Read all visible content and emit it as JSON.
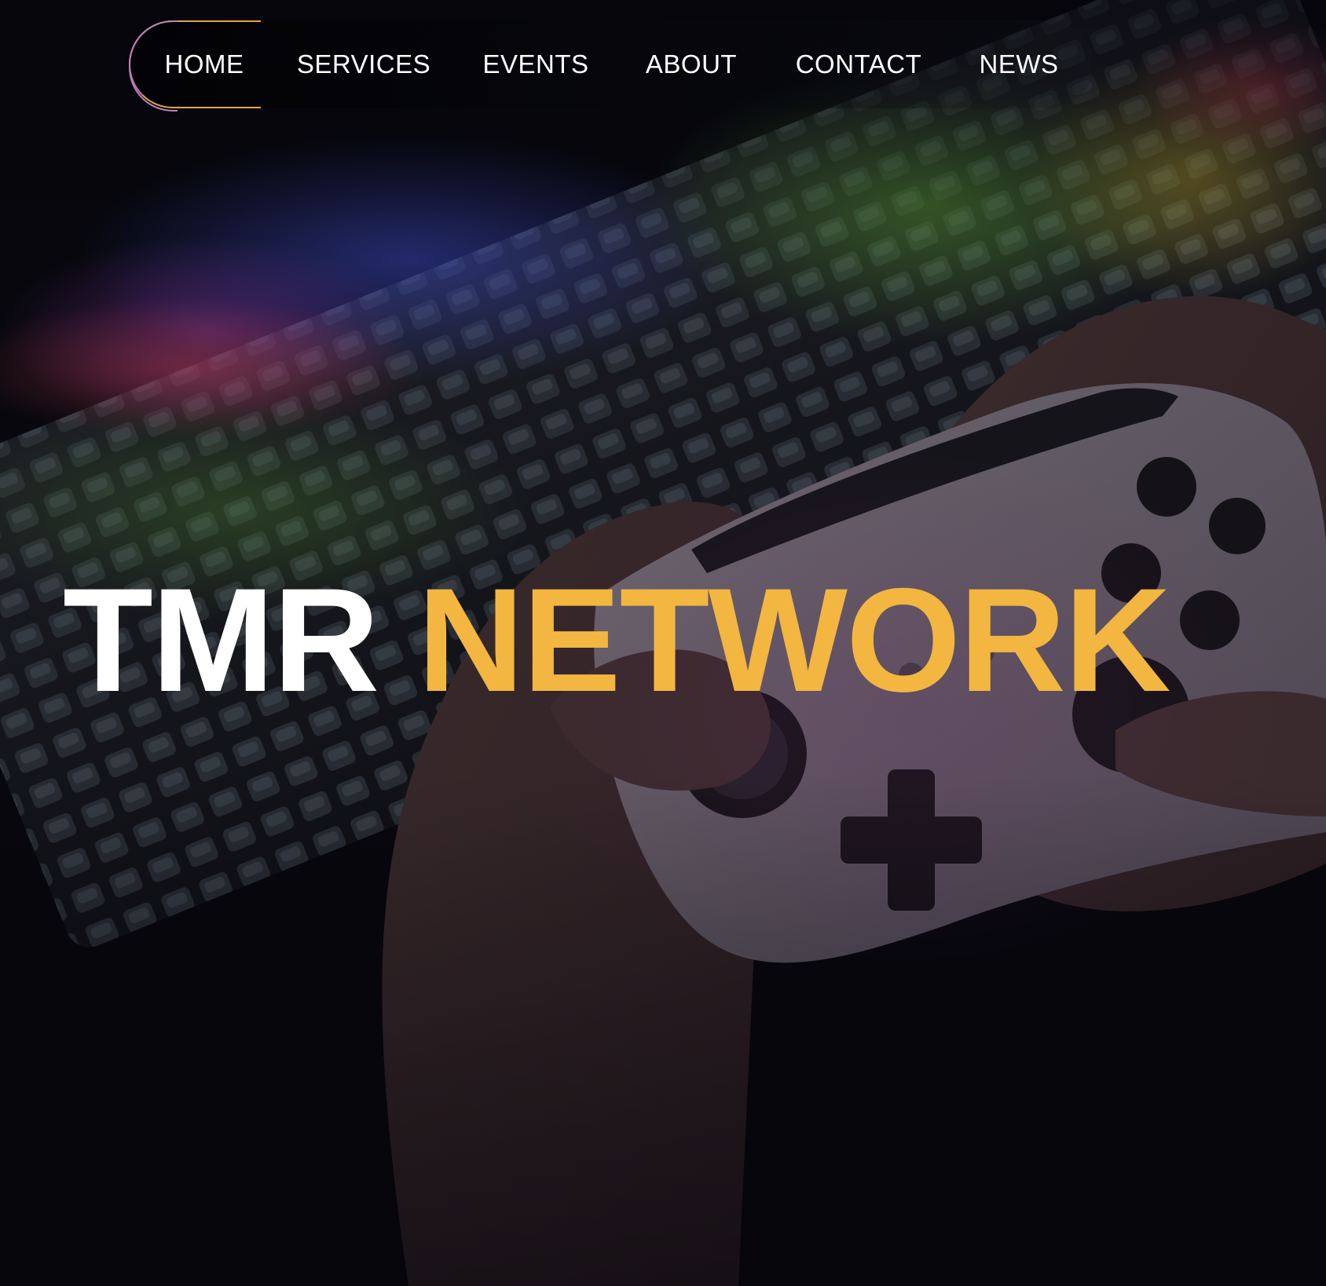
{
  "nav": {
    "items": [
      {
        "label": "HOME",
        "active": true
      },
      {
        "label": "SERVICES",
        "active": false
      },
      {
        "label": "EVENTS",
        "active": false
      },
      {
        "label": "ABOUT",
        "active": false
      },
      {
        "label": "CONTACT",
        "active": false
      },
      {
        "label": "NEWS",
        "active": false
      }
    ]
  },
  "hero": {
    "title_part1": "TMR",
    "title_part2": "NETWORK",
    "background_image": "gaming-controller-and-rgb-keyboard-photo"
  },
  "colors": {
    "accent": "#f2b641",
    "title_primary": "#ffffff",
    "background": "#07060c",
    "active_outline_start": "#b57ab9",
    "active_outline_end": "#e6a24a"
  }
}
